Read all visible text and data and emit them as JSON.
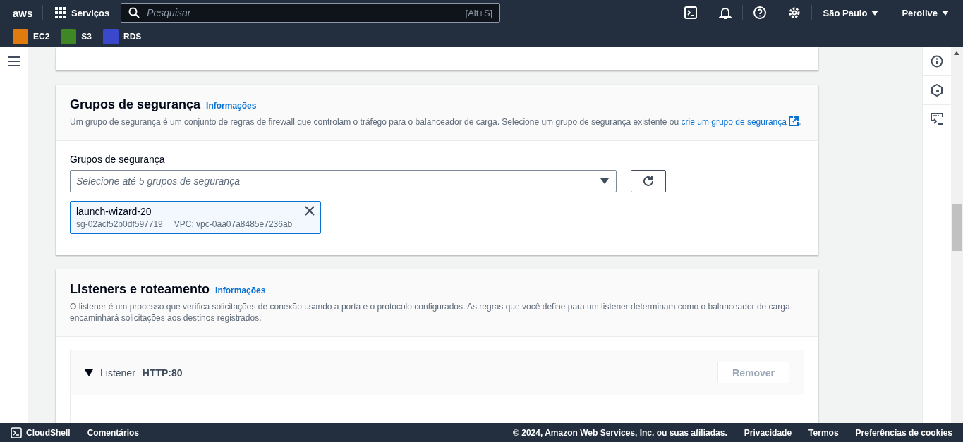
{
  "top_nav": {
    "logo": "aws",
    "services": "Serviços",
    "search": {
      "placeholder": "Pesquisar",
      "shortcut": "[Alt+S]"
    },
    "region": "São Paulo",
    "account": "Perolive"
  },
  "favorites": [
    {
      "label": "EC2",
      "color": "#e07b0f"
    },
    {
      "label": "S3",
      "color": "#3f8624"
    },
    {
      "label": "RDS",
      "color": "#3b48cc"
    }
  ],
  "security_groups": {
    "title": "Grupos de segurança",
    "info": "Informações",
    "description": "Um grupo de segurança é um conjunto de regras de firewall que controlam o tráfego para o balanceador de carga. Selecione um grupo de segurança existente ou",
    "create_link": "crie um grupo de segurança",
    "description_end": ".",
    "field_label": "Grupos de segurança",
    "select": {
      "placeholder": "Selecione até 5 grupos de segurança"
    },
    "tokens": [
      {
        "name": "launch-wizard-20",
        "id": "sg-02acf52b0df597719",
        "vpc": "VPC: vpc-0aa07a8485e7236ab"
      }
    ]
  },
  "listeners": {
    "title": "Listeners e roteamento",
    "info": "Informações",
    "description": "O listener é um processo que verifica solicitações de conexão usando a porta e o protocolo configurados. As regras que você define para um listener determinam como o balanceador de carga encaminhará solicitações aos destinos registrados.",
    "items": [
      {
        "label": "Listener",
        "value": "HTTP:80",
        "expanded": true,
        "remove": "Remover"
      }
    ]
  },
  "footer": {
    "cloudshell": "CloudShell",
    "feedback": "Comentários",
    "copyright": "© 2024, Amazon Web Services, Inc. ou suas afiliadas.",
    "links": [
      "Privacidade",
      "Termos",
      "Preferências de cookies"
    ]
  }
}
